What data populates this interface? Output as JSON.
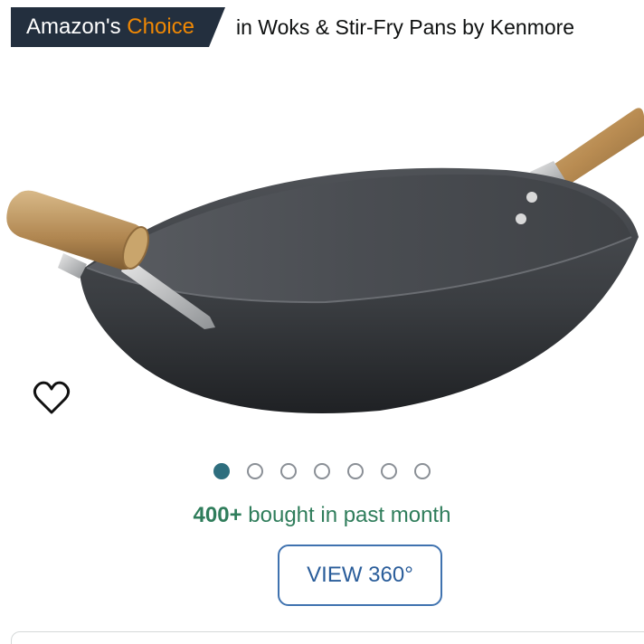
{
  "badge": {
    "prefix": "Amazon's",
    "highlight": "Choice",
    "category_text": "in Woks & Stir-Fry Pans by Kenmore"
  },
  "product_image": {
    "subject": "carbon steel wok with wooden handles"
  },
  "favorite": {
    "icon": "heart-outline-icon"
  },
  "carousel": {
    "total_images": 7,
    "active_index": 0
  },
  "social_proof": {
    "count": "400+",
    "text": "bought in past month"
  },
  "view360": {
    "label": "VIEW 360°"
  },
  "colors": {
    "badge_bg": "#232f3e",
    "badge_choice": "#f08804",
    "active_dot": "#2e6e7e",
    "bought_text": "#2f7d5b",
    "view360_border": "#3f72af"
  }
}
